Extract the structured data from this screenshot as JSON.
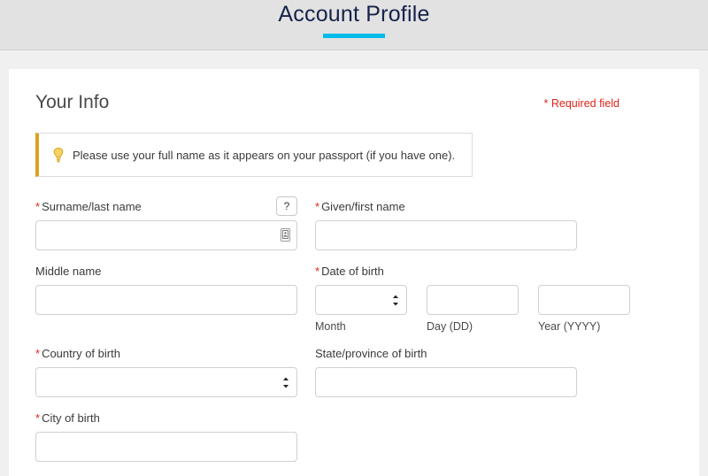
{
  "header": {
    "title": "Account Profile"
  },
  "card": {
    "section_title": "Your Info",
    "required_note": "* Required field",
    "tip": {
      "icon": "lightbulb-icon",
      "text": "Please use your full name as it appears on your passport (if you have one)."
    }
  },
  "fields": {
    "surname": {
      "label": "Surname/last name",
      "required_marker": "*",
      "value": "",
      "placeholder": "",
      "help_button_label": "?",
      "input_icon": "contact-card-icon"
    },
    "given_name": {
      "label": "Given/first name",
      "required_marker": "*",
      "value": "",
      "placeholder": ""
    },
    "middle_name": {
      "label": "Middle name",
      "value": "",
      "placeholder": ""
    },
    "date_of_birth": {
      "label": "Date of birth",
      "required_marker": "*",
      "month": {
        "selected": "",
        "hint": "Month",
        "options": [
          ""
        ]
      },
      "day": {
        "value": "",
        "hint": "Day (DD)",
        "placeholder": ""
      },
      "year": {
        "value": "",
        "hint": "Year (YYYY)",
        "placeholder": ""
      }
    },
    "country_of_birth": {
      "label": "Country of birth",
      "required_marker": "*",
      "selected": "",
      "options": [
        ""
      ]
    },
    "state_of_birth": {
      "label": "State/province of birth",
      "value": "",
      "placeholder": ""
    },
    "city_of_birth": {
      "label": "City of birth",
      "required_marker": "*",
      "value": "",
      "placeholder": ""
    }
  },
  "colors": {
    "accent_cyan": "#00bceb",
    "title_navy": "#16234a",
    "required_red": "#e2231a",
    "tip_border_gold": "#e0a021"
  }
}
